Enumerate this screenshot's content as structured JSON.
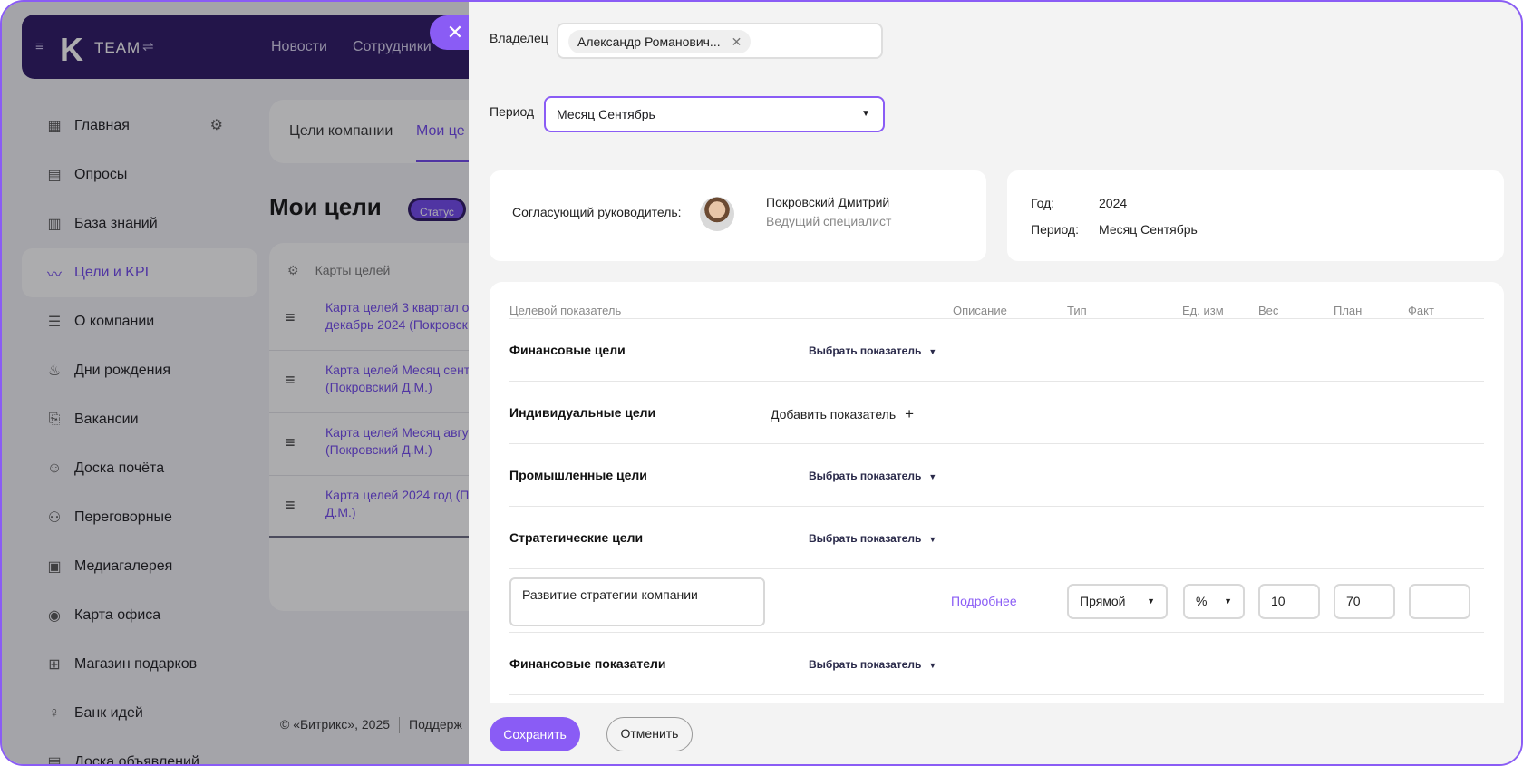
{
  "topbar": {
    "logo_letter": "K",
    "logo_text": "TEAM",
    "nav": [
      "Новости",
      "Сотрудники"
    ]
  },
  "sidebar": {
    "items": [
      {
        "label": "Главная",
        "icon": "dashboard-icon"
      },
      {
        "label": "Опросы",
        "icon": "survey-icon"
      },
      {
        "label": "База знаний",
        "icon": "book-icon"
      },
      {
        "label": "Цели и KPI",
        "icon": "kpi-chart-icon",
        "active": true
      },
      {
        "label": "О компании",
        "icon": "list-icon"
      },
      {
        "label": "Дни рождения",
        "icon": "cake-icon"
      },
      {
        "label": "Вакансии",
        "icon": "document-search-icon"
      },
      {
        "label": "Доска почёта",
        "icon": "user-plus-icon"
      },
      {
        "label": "Переговорные",
        "icon": "meeting-room-icon"
      },
      {
        "label": "Медиагалерея",
        "icon": "image-icon"
      },
      {
        "label": "Карта офиса",
        "icon": "map-pin-icon"
      },
      {
        "label": "Магазин подарков",
        "icon": "cart-icon"
      },
      {
        "label": "Банк идей",
        "icon": "lightbulb-icon"
      },
      {
        "label": "Доска объявлений",
        "icon": "board-icon"
      }
    ]
  },
  "bg_main": {
    "tabs": [
      "Цели компании",
      "Мои це"
    ],
    "title": "Мои цели",
    "status_chip": "Статус",
    "cards_header": [
      "Карты целей"
    ],
    "cards": [
      "Карта целей 3 квартал о\nдекабрь 2024 (Покровск",
      "Карта целей Месяц сент\n(Покровский Д.М.)",
      "Карта целей Месяц авгу\n(Покровский Д.М.)",
      "Карта целей 2024 год (П\nД.М.)"
    ],
    "footer_copyright": "© «Битрикс», 2025",
    "footer_support": "Поддерж"
  },
  "panel": {
    "owner_label": "Владелец",
    "owner_value": "Александр Романович...",
    "period_label": "Период",
    "period_value": "Месяц Сентябрь",
    "approver_label": "Согласующий руководитель:",
    "approver_name": "Покровский Дмитрий",
    "approver_position": "Ведущий специалист",
    "year_key": "Год:",
    "year_value": "2024",
    "period_key": "Период:",
    "period_card_value": "Месяц Сентябрь",
    "columns": [
      "Целевой показатель",
      "Описание",
      "Тип",
      "Ед. изм",
      "Вес",
      "План",
      "Факт"
    ],
    "groups": [
      {
        "name": "Финансовые цели",
        "action": "Выбрать показатель"
      },
      {
        "name": "Индивидуальные цели",
        "action": "Добавить показатель"
      },
      {
        "name": "Промышленные цели",
        "action": "Выбрать показатель"
      },
      {
        "name": "Стратегические цели",
        "action": "Выбрать показатель"
      },
      {
        "name": "Финансовые показатели",
        "action": "Выбрать показатель"
      }
    ],
    "indicator": {
      "name": "Развитие стратегии компании",
      "more": "Подробнее",
      "type": "Прямой",
      "unit": "%",
      "weight": "10",
      "plan": "70",
      "fact": ""
    },
    "save": "Сохранить",
    "cancel": "Отменить"
  }
}
